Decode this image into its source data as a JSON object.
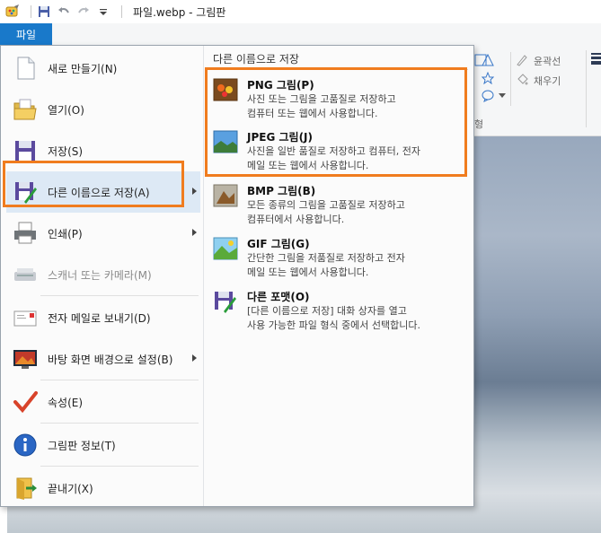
{
  "titlebar": {
    "title": "파일.webp - 그림판"
  },
  "ribbon": {
    "file_tab": "파일",
    "outline_label": "윤곽선",
    "fill_label": "채우기",
    "group_label": "형"
  },
  "menu": {
    "items": [
      {
        "label": "새로 만들기(N)",
        "icon": "new-file-icon"
      },
      {
        "label": "열기(O)",
        "icon": "open-folder-icon"
      },
      {
        "label": "저장(S)",
        "icon": "save-disk-icon"
      },
      {
        "label": "다른 이름으로 저장(A)",
        "icon": "save-as-icon"
      },
      {
        "label": "인쇄(P)",
        "icon": "printer-icon"
      },
      {
        "label": "스캐너 또는 카메라(M)",
        "icon": "scanner-icon"
      },
      {
        "label": "전자 메일로 보내기(D)",
        "icon": "email-icon"
      },
      {
        "label": "바탕 화면 배경으로 설정(B)",
        "icon": "desktop-background-icon"
      },
      {
        "label": "속성(E)",
        "icon": "properties-check-icon"
      },
      {
        "label": "그림판 정보(T)",
        "icon": "info-icon"
      },
      {
        "label": "끝내기(X)",
        "icon": "exit-icon"
      }
    ]
  },
  "submenu": {
    "header": "다른 이름으로 저장",
    "items": [
      {
        "title": "PNG 그림(P)",
        "desc": "사진 또는 그림을 고품질로 저장하고\n컴퓨터 또는 웹에서 사용합니다.",
        "icon": "png-image-icon"
      },
      {
        "title": "JPEG 그림(J)",
        "desc": "사진을 일반 품질로 저장하고 컴퓨터, 전자\n메일 또는 웹에서 사용합니다.",
        "icon": "jpeg-image-icon"
      },
      {
        "title": "BMP 그림(B)",
        "desc": "모든 종류의 그림을 고품질로 저장하고\n컴퓨터에서 사용합니다.",
        "icon": "bmp-image-icon"
      },
      {
        "title": "GIF 그림(G)",
        "desc": "간단한 그림을 저품질로 저장하고 전자\n메일 또는 웹에서 사용합니다.",
        "icon": "gif-image-icon"
      },
      {
        "title": "다른 포맷(O)",
        "desc": "[다른 이름으로 저장] 대화 상자를 열고\n사용 가능한 파일 형식 중에서 선택합니다.",
        "icon": "other-format-icon"
      }
    ]
  },
  "colors": {
    "highlight": "#f07c1e",
    "file_tab": "#1979ca"
  }
}
